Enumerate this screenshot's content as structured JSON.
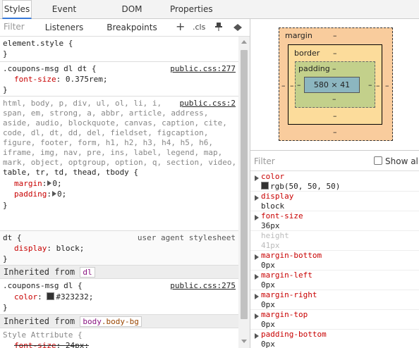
{
  "tabs": [
    "Styles",
    "Event Listeners",
    "DOM Breakpoints",
    "Properties"
  ],
  "styles_toolbar": {
    "filter_placeholder": "Filter",
    "plus": "+",
    "cls": ".cls"
  },
  "rules": {
    "element_style": {
      "selector": "element.style {",
      "close": "}"
    },
    "rule1": {
      "selector": ".coupons-msg dl dt {",
      "source": "public.css:277",
      "prop": "font-size",
      "value": "0.375rem;",
      "close": "}"
    },
    "rule2": {
      "selector_lines": [
        "html, body, p, div, ul, ol, li, i,",
        "span, em, strong, a, abbr, article, address,",
        "aside, audio, blockquote, canvas, caption, cite,",
        "code, dl, dt, dd, del, fieldset, figcaption,",
        "figure, footer, form, h1, h2, h3, h4, h5, h6,",
        "iframe, img, nav, pre, ins, label, legend, map,",
        "mark, object, optgroup, option, q, section, video,",
        "table, tr, td, thead, tbody {"
      ],
      "source": "public.css:2",
      "props": [
        {
          "name": "margin",
          "value": "0;"
        },
        {
          "name": "padding",
          "value": "0;"
        }
      ],
      "close": "}"
    },
    "rule3": {
      "selector": "dt {",
      "source": "user agent stylesheet",
      "prop": "display",
      "value": "block;",
      "close": "}"
    },
    "inherited1": {
      "label": "Inherited from",
      "chip": "dl"
    },
    "rule4": {
      "selector": ".coupons-msg dl {",
      "source": "public.css:275",
      "prop": "color",
      "value": "#323232;",
      "close": "}"
    },
    "inherited2": {
      "label": "Inherited from",
      "chip_tag": "body",
      "chip_class": ".body-bg"
    },
    "style_attr": {
      "selector": "Style Attribute {",
      "prop": "font-size",
      "value": "24px;",
      "close": "}"
    }
  },
  "box_model": {
    "margin_label": "margin",
    "border_label": "border",
    "padding_label": "padding",
    "content": "580 × 41",
    "dash": "–"
  },
  "computed": {
    "filter_placeholder": "Filter",
    "show_all": "Show all",
    "items": [
      {
        "name": "color",
        "value": "rgb(50, 50, 50)"
      },
      {
        "name": "display",
        "value": "block"
      },
      {
        "name": "font-size",
        "value": "36px"
      },
      {
        "name": "height",
        "value": "41px"
      },
      {
        "name": "margin-bottom",
        "value": "0px"
      },
      {
        "name": "margin-left",
        "value": "0px"
      },
      {
        "name": "margin-right",
        "value": "0px"
      },
      {
        "name": "margin-top",
        "value": "0px"
      },
      {
        "name": "padding-bottom",
        "value": "0px"
      }
    ]
  },
  "colors": {
    "swatch": "#323232",
    "prop_red": "#c80000",
    "active_tab": "#3879d9"
  }
}
